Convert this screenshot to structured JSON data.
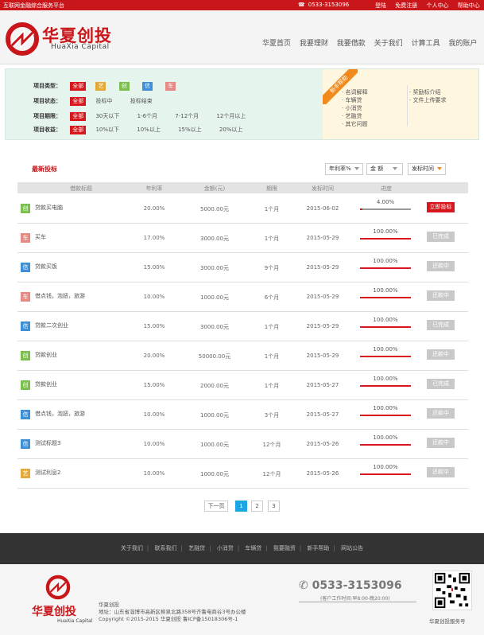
{
  "topbar": {
    "slogan": "互联网金融综合服务平台",
    "phone": "0533-3153096",
    "links": [
      "登陆",
      "免费注册",
      "个人中心",
      "帮助中心"
    ]
  },
  "logo": {
    "cn": "华夏创投",
    "en": "HuaXia  Capital"
  },
  "nav": [
    "华夏首页",
    "我要理财",
    "我要借款",
    "关于我们",
    "计算工具",
    "我的账户"
  ],
  "filters": {
    "type_label": "项目类型：",
    "type_all": "全部",
    "type_icons": [
      "艺",
      "创",
      "信",
      "车"
    ],
    "status_label": "项目状态：",
    "status_all": "全部",
    "status_opts": [
      "投标中",
      "投标结束"
    ],
    "period_label": "项目期限：",
    "period_all": "全部",
    "period_opts": [
      "30天以下",
      "1-6个月",
      "7-12个月",
      "12个月以上"
    ],
    "yield_label": "项目收益：",
    "yield_all": "全部",
    "yield_opts": [
      "10%以下",
      "10%以上",
      "15%以上",
      "20%以上"
    ]
  },
  "help": {
    "ribbon": "新手帮助",
    "left": [
      "名词解释",
      "车辆贷",
      "小消贷",
      "艺融贷",
      "其它问题"
    ],
    "right": [
      "奖励标介绍",
      "文件上传要求"
    ]
  },
  "list": {
    "title": "最新投标",
    "sort": [
      "年利率%",
      "金 额",
      "发标时间"
    ],
    "columns": [
      "借款标题",
      "年利率",
      "金额(元)",
      "期限",
      "发标时间",
      "进度"
    ],
    "rows": [
      {
        "icon": "创",
        "color": "#7bbf4e",
        "title": "贷款买电脑",
        "rate": "20.00%",
        "amount": "5000.00元",
        "term": "1个月",
        "date": "2015-06-02",
        "progress": 4,
        "progress_label": "4.00%",
        "action": "立即投标",
        "active": true
      },
      {
        "icon": "车",
        "color": "#e58a86",
        "title": "买车",
        "rate": "17.00%",
        "amount": "3000.00元",
        "term": "1个月",
        "date": "2015-05-29",
        "progress": 100,
        "progress_label": "100.00%",
        "action": "已完成",
        "active": false
      },
      {
        "icon": "信",
        "color": "#3e8fd6",
        "title": "贷款买饭",
        "rate": "15.00%",
        "amount": "3000.00元",
        "term": "9个月",
        "date": "2015-05-29",
        "progress": 100,
        "progress_label": "100.00%",
        "action": "还款中",
        "active": false
      },
      {
        "icon": "车",
        "color": "#e58a86",
        "title": "借点钱，泡妞，旅游",
        "rate": "10.00%",
        "amount": "1000.00元",
        "term": "6个月",
        "date": "2015-05-29",
        "progress": 100,
        "progress_label": "100.00%",
        "action": "还款中",
        "active": false
      },
      {
        "icon": "信",
        "color": "#3e8fd6",
        "title": "贷款二次创业",
        "rate": "15.00%",
        "amount": "3000.00元",
        "term": "1个月",
        "date": "2015-05-29",
        "progress": 100,
        "progress_label": "100.00%",
        "action": "已完成",
        "active": false
      },
      {
        "icon": "创",
        "color": "#7bbf4e",
        "title": "贷款创业",
        "rate": "20.00%",
        "amount": "50000.00元",
        "term": "1个月",
        "date": "2015-05-29",
        "progress": 100,
        "progress_label": "100.00%",
        "action": "还款中",
        "active": false
      },
      {
        "icon": "创",
        "color": "#7bbf4e",
        "title": "贷款创业",
        "rate": "15.00%",
        "amount": "2000.00元",
        "term": "1个月",
        "date": "2015-05-27",
        "progress": 100,
        "progress_label": "100.00%",
        "action": "已完成",
        "active": false
      },
      {
        "icon": "信",
        "color": "#3e8fd6",
        "title": "借点钱，泡妞，旅游",
        "rate": "10.00%",
        "amount": "1000.00元",
        "term": "3个月",
        "date": "2015-05-27",
        "progress": 100,
        "progress_label": "100.00%",
        "action": "还款中",
        "active": false
      },
      {
        "icon": "信",
        "color": "#3e8fd6",
        "title": "测试标题3",
        "rate": "10.00%",
        "amount": "1000.00元",
        "term": "12个月",
        "date": "2015-05-26",
        "progress": 100,
        "progress_label": "100.00%",
        "action": "还款中",
        "active": false
      },
      {
        "icon": "艺",
        "color": "#e5a93a",
        "title": "测试利息2",
        "rate": "10.00%",
        "amount": "1000.00元",
        "term": "12个月",
        "date": "2015-05-26",
        "progress": 100,
        "progress_label": "100.00%",
        "action": "还款中",
        "active": false
      }
    ]
  },
  "pager": {
    "prev": "下一页",
    "pages": [
      "1",
      "2",
      "3"
    ],
    "current": "1"
  },
  "footer": {
    "links": [
      "关于我们",
      "联系我们",
      "艺融贷",
      "小消贷",
      "车辆贷",
      "我要融资",
      "新手帮助",
      "网站公告"
    ],
    "company": "华夏创投",
    "address": "地址：山东省淄博市高新区柳泉北路358号齐鲁电商谷3号办公楼",
    "copyright": "Copyright ©2015-2015 华夏创投 鲁ICP备15018306号-1",
    "phone": "0533-3153096",
    "hours": "(客户工作时间:早8:00-晚20:00)",
    "qr_caption": "华夏创投服务号"
  },
  "colors": {
    "brand": "#c9161a",
    "accent": "#1aa5e3",
    "help_ribbon": "#f08a1c"
  }
}
